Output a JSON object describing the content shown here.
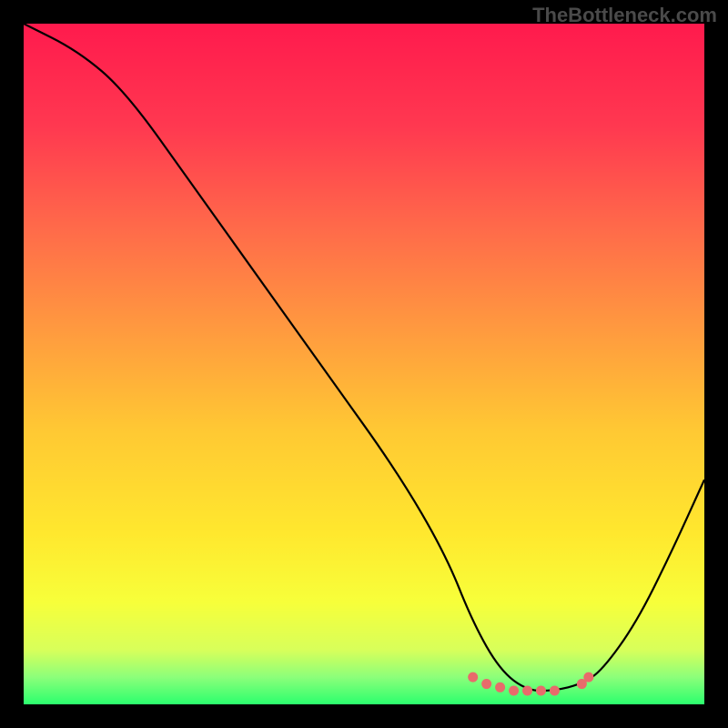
{
  "watermark": "TheBottleneck.com",
  "chart_data": {
    "type": "line",
    "title": "",
    "xlabel": "",
    "ylabel": "",
    "xlim": [
      0,
      100
    ],
    "ylim": [
      0,
      100
    ],
    "series": [
      {
        "name": "bottleneck-curve",
        "x": [
          0,
          8,
          15,
          25,
          35,
          45,
          55,
          62,
          66,
          70,
          74,
          78,
          82,
          85,
          90,
          95,
          100
        ],
        "y": [
          100,
          96,
          90,
          76,
          62,
          48,
          34,
          22,
          12,
          5,
          2,
          2,
          3,
          5,
          12,
          22,
          33
        ]
      }
    ],
    "markers": {
      "name": "optimal-range-dots",
      "x": [
        66,
        68,
        70,
        72,
        74,
        76,
        78,
        82,
        83
      ],
      "y": [
        4,
        3,
        2.5,
        2,
        2,
        2,
        2,
        3,
        4
      ]
    },
    "gradient_stops": [
      {
        "offset": 0.0,
        "color": "#ff1a4d"
      },
      {
        "offset": 0.15,
        "color": "#ff3850"
      },
      {
        "offset": 0.3,
        "color": "#ff6a4a"
      },
      {
        "offset": 0.45,
        "color": "#ff9a3f"
      },
      {
        "offset": 0.6,
        "color": "#ffc933"
      },
      {
        "offset": 0.75,
        "color": "#ffe82e"
      },
      {
        "offset": 0.85,
        "color": "#f7ff3a"
      },
      {
        "offset": 0.92,
        "color": "#d8ff5a"
      },
      {
        "offset": 0.96,
        "color": "#8cff7a"
      },
      {
        "offset": 1.0,
        "color": "#2bff6e"
      }
    ],
    "curve_color": "#000000",
    "marker_color": "#e86b6b"
  }
}
